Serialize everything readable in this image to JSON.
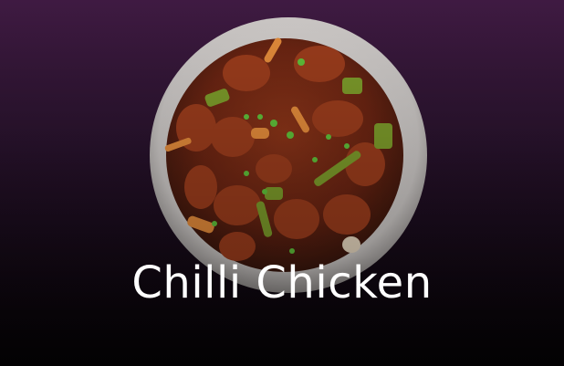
{
  "dish": {
    "name": "Chilli Chicken",
    "image_icon": "chilli-chicken-plate-photo"
  }
}
